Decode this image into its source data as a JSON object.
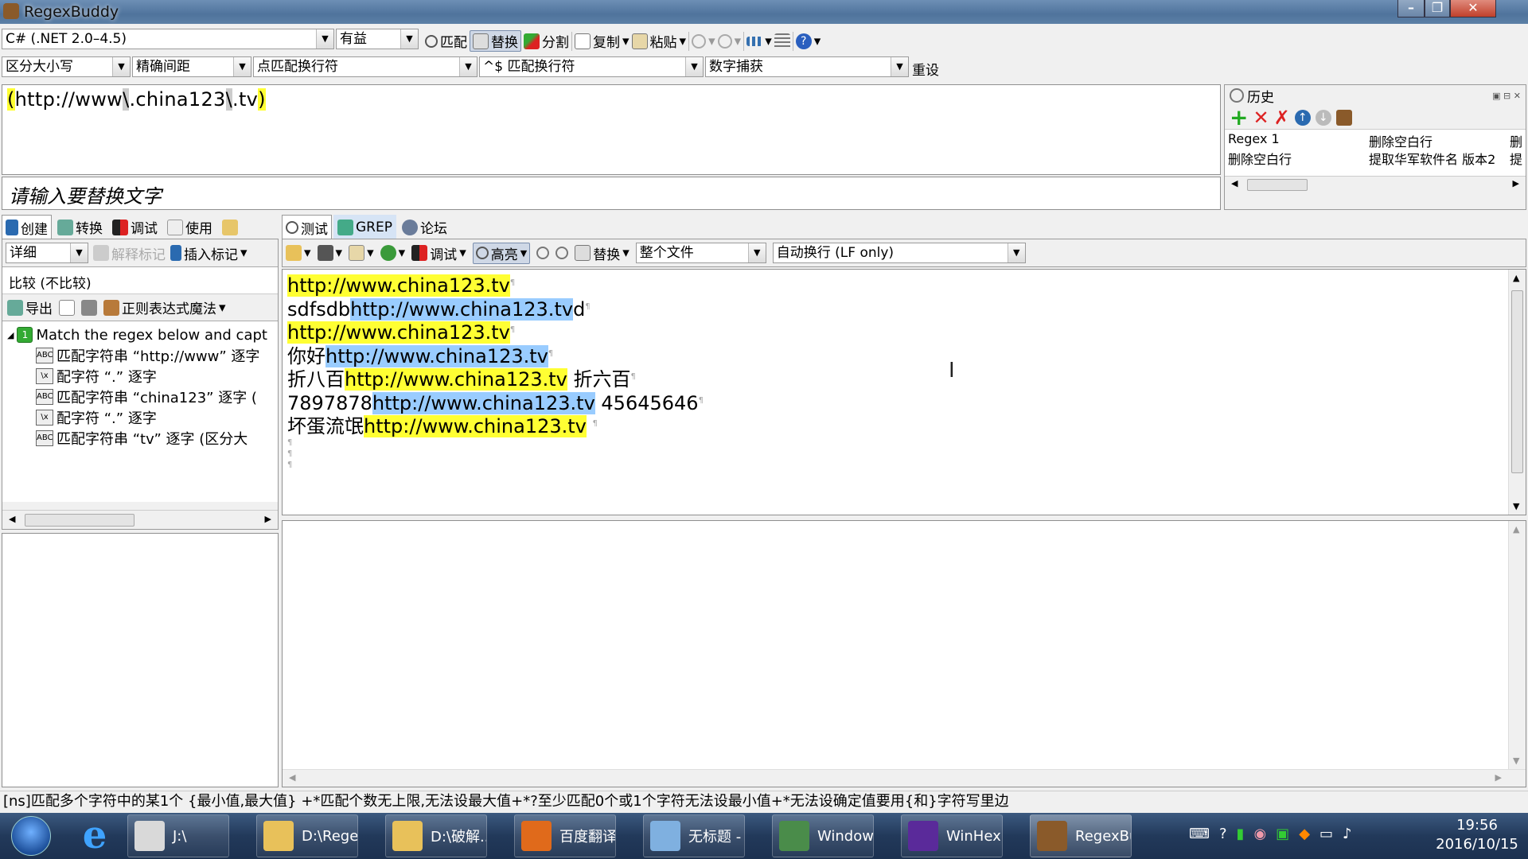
{
  "window": {
    "title": "RegexBuddy"
  },
  "toolbar1": {
    "flavor": "C# (.NET 2.0–4.5)",
    "mode": "有益",
    "match": "匹配",
    "replace": "替换",
    "split": "分割",
    "copy": "复制",
    "paste": "粘贴"
  },
  "toolbar2": {
    "case": "区分大小写",
    "spacing": "精确间距",
    "dot": "点匹配换行符",
    "anchors": "^$ 匹配换行符",
    "capture": "数字捕获",
    "reset": "重设"
  },
  "regex": {
    "parts": [
      {
        "text": "(",
        "hl": "y"
      },
      {
        "text": "http://www",
        "hl": ""
      },
      {
        "text": "\\",
        "hl": "g"
      },
      {
        "text": ".china123",
        "hl": ""
      },
      {
        "text": "\\",
        "hl": "g"
      },
      {
        "text": ".tv",
        "hl": ""
      },
      {
        "text": ")",
        "hl": "y"
      }
    ],
    "replace_placeholder": "请输入要替换文字"
  },
  "history": {
    "title": "历史",
    "rows": [
      [
        "Regex 1",
        "删除空白行",
        "删"
      ],
      [
        "删除空白行",
        "提取华军软件名 版本2",
        "提"
      ]
    ]
  },
  "left_tabs": [
    "创建",
    "转换",
    "调试",
    "使用"
  ],
  "left": {
    "detail": "详细",
    "annotate": "解释标记",
    "insert": "插入标记",
    "compare": "比较 (不比较)",
    "export": "导出",
    "magic": "正则表达式魔法",
    "tree_root": "Match the regex below and capt",
    "tree_items": [
      {
        "icon": "ABC",
        "text": "匹配字符串 “http://www” 逐字"
      },
      {
        "icon": "\\x",
        "text": "配字符 “.” 逐字"
      },
      {
        "icon": "ABC",
        "text": "匹配字符串 “china123” 逐字 ("
      },
      {
        "icon": "\\x",
        "text": "配字符 “.” 逐字"
      },
      {
        "icon": "ABC",
        "text": "匹配字符串 “tv” 逐字 (区分大"
      }
    ]
  },
  "right_tabs": [
    "测试",
    "GREP",
    "论坛"
  ],
  "test_toolbar": {
    "debug": "调试",
    "highlight": "高亮",
    "replace": "替换",
    "scope": "整个文件",
    "wrap": "自动换行 (LF only)"
  },
  "test_lines": [
    [
      {
        "t": "http://www.china123.tv",
        "h": "y"
      }
    ],
    [
      {
        "t": "sdfsdb",
        "h": ""
      },
      {
        "t": "http://www.china123.tv",
        "h": "b"
      },
      {
        "t": "d",
        "h": ""
      }
    ],
    [
      {
        "t": "http://www.china123.tv",
        "h": "y"
      }
    ],
    [
      {
        "t": "你好",
        "h": ""
      },
      {
        "t": "http://www.china123.tv",
        "h": "b"
      }
    ],
    [
      {
        "t": "折八百",
        "h": ""
      },
      {
        "t": "http://www.china123.tv",
        "h": "y"
      },
      {
        "t": " 折六百",
        "h": ""
      }
    ],
    [
      {
        "t": "7897878",
        "h": ""
      },
      {
        "t": "http://www.china123.tv",
        "h": "b"
      },
      {
        "t": " 45645646",
        "h": ""
      }
    ],
    [
      {
        "t": "坏蛋流氓",
        "h": ""
      },
      {
        "t": "http://www.china123.tv",
        "h": "y"
      },
      {
        "t": " ",
        "h": ""
      }
    ],
    [],
    [],
    []
  ],
  "status": "[ns]匹配多个字符中的某1个 {最小值,最大值} +*匹配个数无上限,无法设最大值+*?至少匹配0个或1个字符无法设最小值+*无法设确定值要用{和}字符写里边",
  "taskbar": {
    "items": [
      {
        "label": "J:\\",
        "color": "#d9d9d9"
      },
      {
        "label": "D:\\Rege...",
        "color": "#e8c15a"
      },
      {
        "label": "D:\\破解...",
        "color": "#e8c15a"
      },
      {
        "label": "百度翻译...",
        "color": "#e06a1b"
      },
      {
        "label": "无标题 - ...",
        "color": "#7fb0e0"
      },
      {
        "label": "Window...",
        "color": "#4a8c4a"
      },
      {
        "label": "WinHex ...",
        "color": "#5a2a9a"
      },
      {
        "label": "RegexBu...",
        "color": "#8a5a2a"
      }
    ],
    "time": "19:56",
    "date": "2016/10/15"
  },
  "colors": {
    "yellow": "#ffff33",
    "blue": "#99ccff",
    "accent": "#2a6ab0"
  }
}
